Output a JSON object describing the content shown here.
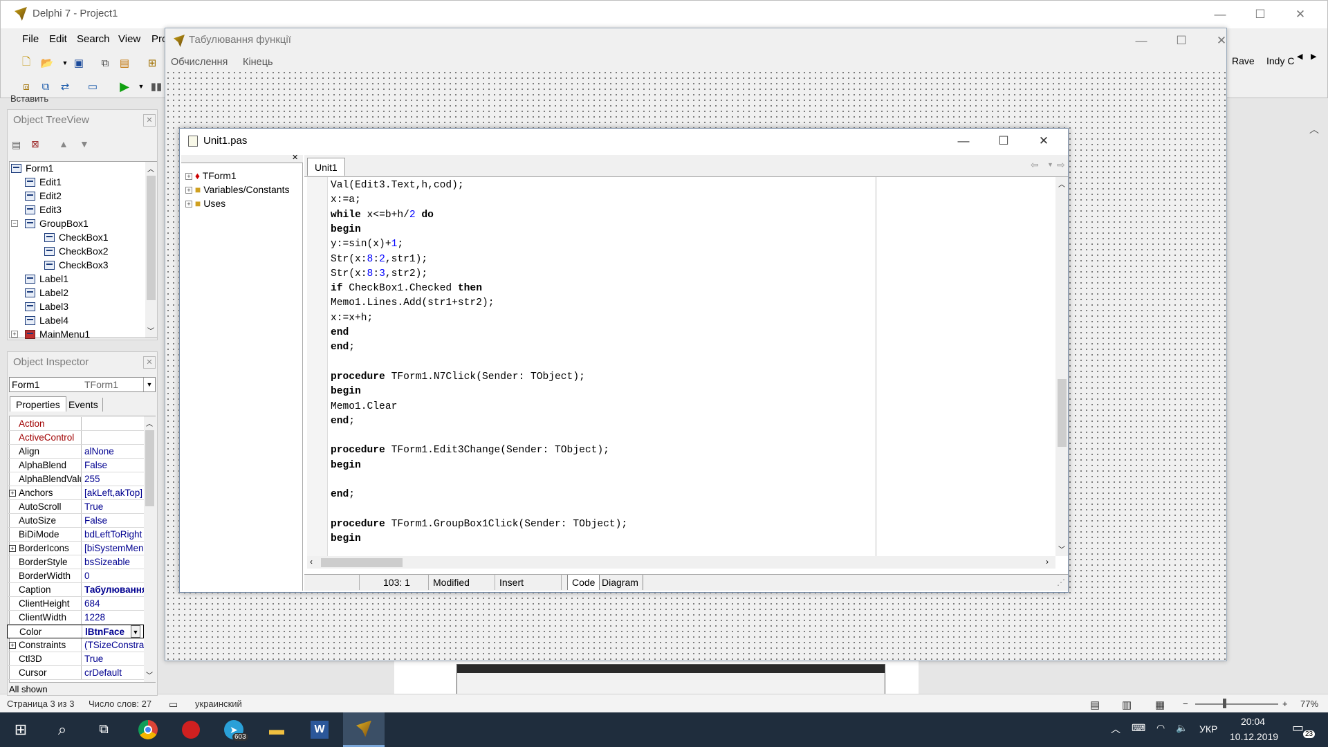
{
  "word": {
    "page_info": "Страница 3 из 3",
    "word_count": "Число слов: 27",
    "language": "украинский",
    "zoom": "77%"
  },
  "delphi": {
    "title": "Delphi 7 - Project1",
    "menu": [
      "File",
      "Edit",
      "Search",
      "View",
      "Pro"
    ],
    "palette_right": [
      "Rave",
      "Indy C"
    ],
    "palette_tab_left": "Вставить"
  },
  "treeview": {
    "title": "Object TreeView",
    "items": [
      {
        "label": "Form1",
        "level": 0
      },
      {
        "label": "Edit1",
        "level": 1
      },
      {
        "label": "Edit2",
        "level": 1
      },
      {
        "label": "Edit3",
        "level": 1
      },
      {
        "label": "GroupBox1",
        "level": 1
      },
      {
        "label": "CheckBox1",
        "level": 2
      },
      {
        "label": "CheckBox2",
        "level": 2
      },
      {
        "label": "CheckBox3",
        "level": 2
      },
      {
        "label": "Label1",
        "level": 1
      },
      {
        "label": "Label2",
        "level": 1
      },
      {
        "label": "Label3",
        "level": 1
      },
      {
        "label": "Label4",
        "level": 1
      },
      {
        "label": "MainMenu1",
        "level": 1
      }
    ]
  },
  "inspector": {
    "title": "Object Inspector",
    "selected_object": "Form1",
    "selected_type": "TForm1",
    "tabs": [
      "Properties",
      "Events"
    ],
    "rows": [
      {
        "name": "Action",
        "value": "",
        "event": true
      },
      {
        "name": "ActiveControl",
        "value": "",
        "event": true
      },
      {
        "name": "Align",
        "value": "alNone"
      },
      {
        "name": "AlphaBlend",
        "value": "False"
      },
      {
        "name": "AlphaBlendValu",
        "value": "255"
      },
      {
        "name": "Anchors",
        "value": "[akLeft,akTop]",
        "plus": true
      },
      {
        "name": "AutoScroll",
        "value": "True"
      },
      {
        "name": "AutoSize",
        "value": "False"
      },
      {
        "name": "BiDiMode",
        "value": "bdLeftToRight"
      },
      {
        "name": "BorderIcons",
        "value": "[biSystemMenu]",
        "plus": true
      },
      {
        "name": "BorderStyle",
        "value": "bsSizeable"
      },
      {
        "name": "BorderWidth",
        "value": "0"
      },
      {
        "name": "Caption",
        "value": "Табулювання",
        "bold": true
      },
      {
        "name": "ClientHeight",
        "value": "684"
      },
      {
        "name": "ClientWidth",
        "value": "1228"
      },
      {
        "name": "Color",
        "value": "lBtnFace",
        "bold": true
      },
      {
        "name": "Constraints",
        "value": "(TSizeConstra",
        "plus": true
      },
      {
        "name": "Ctl3D",
        "value": "True"
      },
      {
        "name": "Cursor",
        "value": "crDefault"
      }
    ],
    "footer": "All shown"
  },
  "form": {
    "title": "Табулювання функції",
    "menu": [
      "Обчислення",
      "Кінець"
    ]
  },
  "editor": {
    "title": "Unit1.pas",
    "tab": "Unit1",
    "explorer": [
      "TForm1",
      "Variables/Constants",
      "Uses"
    ],
    "code": [
      [
        [
          "Val(Edit3.Text,h,cod);",
          ""
        ]
      ],
      [
        [
          "x:=a;",
          ""
        ]
      ],
      [
        [
          "while",
          "kw"
        ],
        [
          " x<=b+h/",
          ""
        ],
        [
          "2",
          "num"
        ],
        [
          " ",
          ""
        ],
        [
          "do",
          "kw"
        ]
      ],
      [
        [
          "begin",
          "kw"
        ]
      ],
      [
        [
          "y:=sin(x)+",
          ""
        ],
        [
          "1",
          "num"
        ],
        [
          ";",
          ""
        ]
      ],
      [
        [
          "Str(x:",
          ""
        ],
        [
          "8",
          "num"
        ],
        [
          ":",
          ""
        ],
        [
          "2",
          "num"
        ],
        [
          ",str1);",
          ""
        ]
      ],
      [
        [
          "Str(x:",
          ""
        ],
        [
          "8",
          "num"
        ],
        [
          ":",
          ""
        ],
        [
          "3",
          "num"
        ],
        [
          ",str2);",
          ""
        ]
      ],
      [
        [
          "if",
          "kw"
        ],
        [
          " CheckBox1.Checked ",
          ""
        ],
        [
          "then",
          "kw"
        ]
      ],
      [
        [
          "Memo1.Lines.Add(str1+str2);",
          ""
        ]
      ],
      [
        [
          "x:=x+h;",
          ""
        ]
      ],
      [
        [
          "end",
          "kw"
        ]
      ],
      [
        [
          "end",
          "kw"
        ],
        [
          ";",
          ""
        ]
      ],
      [
        [
          "",
          ""
        ]
      ],
      [
        [
          "procedure",
          "kw"
        ],
        [
          " TForm1.N7Click(Sender: TObject);",
          ""
        ]
      ],
      [
        [
          "begin",
          "kw"
        ]
      ],
      [
        [
          "Memo1.Clear",
          ""
        ]
      ],
      [
        [
          "end",
          "kw"
        ],
        [
          ";",
          ""
        ]
      ],
      [
        [
          "",
          ""
        ]
      ],
      [
        [
          "procedure",
          "kw"
        ],
        [
          " TForm1.Edit3Change(Sender: TObject);",
          ""
        ]
      ],
      [
        [
          "begin",
          "kw"
        ]
      ],
      [
        [
          "",
          ""
        ]
      ],
      [
        [
          "end",
          "kw"
        ],
        [
          ";",
          ""
        ]
      ],
      [
        [
          "",
          ""
        ]
      ],
      [
        [
          "procedure",
          "kw"
        ],
        [
          " TForm1.GroupBox1Click(Sender: TObject);",
          ""
        ]
      ],
      [
        [
          "begin",
          "kw"
        ]
      ]
    ],
    "status": {
      "position": "103:  1",
      "modified": "Modified",
      "mode": "Insert",
      "tabs": [
        "Code",
        "Diagram"
      ]
    }
  },
  "taskbar": {
    "lang": "УКР",
    "time": "20:04",
    "date": "10.12.2019",
    "notifications": "23",
    "telegram_badge": "603"
  },
  "colors": {
    "taskbar": "#1f2d3d",
    "accent_red": "#a00000",
    "value_blue": "#000090"
  }
}
